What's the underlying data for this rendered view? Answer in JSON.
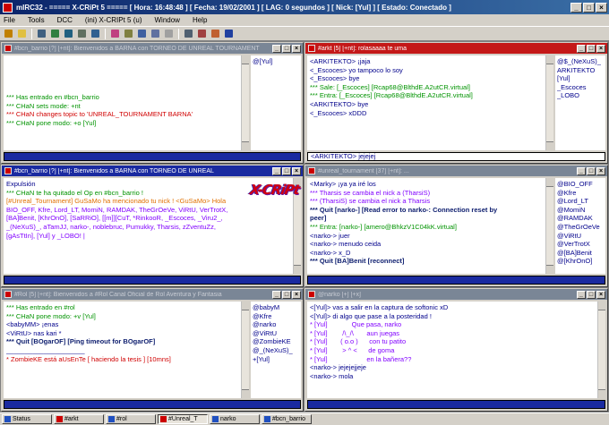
{
  "app": {
    "title": "mIRC32 - ===== X-CRiPt 5 ===== [ Hora: 16:48:48 ] [ Fecha: 19/02/2001 ] [ LAG: 0 segundos ] [ Nick: [Yul] ] [ Estado: Conectado ]",
    "min": "_",
    "max": "□",
    "close": "×"
  },
  "menu": [
    "File",
    "Tools",
    "DCC",
    "(ini) X-CRIPt 5 (u)",
    "Window",
    "Help"
  ],
  "toolbar": {
    "icons": [
      "lightning-icon",
      "folder-icon",
      "options-icon",
      "address-book-icon",
      "channels-icon",
      "dcc-send-icon",
      "dcc-chat-icon",
      "colors-icon",
      "logs-icon",
      "scripts-icon",
      "notify-icon",
      "url-icon",
      "tile-icon",
      "cascade-icon",
      "ignore-icon",
      "help-icon"
    ],
    "colors": [
      "#c08000",
      "#e0c040",
      "#406080",
      "#308040",
      "#206080",
      "#607060",
      "#306090",
      "#c04080",
      "#808040",
      "#4060a0",
      "#6070a0",
      "#a0a0a0",
      "#506070",
      "#a04040",
      "#c06030",
      "#2040a0"
    ]
  },
  "windows": {
    "top_left": {
      "title": "#bcn_barrio [?] [+nt]: Bienvenidos a BARNA con TORNEO DE UNREAL TOURNAMENT",
      "lines": [
        {
          "t": "*** Has entrado en #bcn_barrio",
          "c": "c-green"
        },
        {
          "t": "*** CHaN sets mode: +nt",
          "c": "c-green"
        },
        {
          "t": "*** CHaN changes topic to 'UNREAL_TOURNAMENT BARNA'",
          "c": "c-red"
        },
        {
          "t": "*** CHaN pone modo: +o [Yul]",
          "c": "c-green"
        }
      ],
      "nicks": [
        "@[Yul]"
      ]
    },
    "top_right": {
      "title": "#arkt [5] [+nt]: rolasaaaa te uma",
      "lines": [
        {
          "t": "<ARKITEKTO> ¡jaja",
          "c": "c-blue"
        },
        {
          "t": "<_Escoces> yo tampoco lo soy",
          "c": "c-blue"
        },
        {
          "t": "<_Escoces> bye",
          "c": "c-blue"
        },
        {
          "t": "*** Sale: [_Escoces] [Rcap68@BlthdE.A2utCR.virtual]",
          "c": "c-green"
        },
        {
          "t": "*** Entra: [_Escoces] [Rcap68@BlthdE.A2utCR.virtual]",
          "c": "c-green"
        },
        {
          "t": "<ARKITEKTO> bye",
          "c": "c-blue"
        },
        {
          "t": "<_Escoces> xDDD",
          "c": "c-blue"
        }
      ],
      "input_line": "<ARKITEKTO> jejejej",
      "nicks": [
        "@$_(NeXuS)_",
        "ARKITEKTO",
        "[Yul]",
        "_Escoces",
        "_LOBO"
      ]
    },
    "middle_left": {
      "title": "#bcn_barrio [?] [+nt]: Bienvenidos a BARNA con TORNEO DE UNREAL",
      "lines": [
        {
          "t": "Expulsión",
          "c": "c-blue"
        },
        {
          "t": "*** CHaN te ha quitado el Op en #bcn_barrio !",
          "c": "c-green"
        },
        {
          "t": "",
          "c": ""
        },
        {
          "t": "[#Unreal_Tournament] GuSaMo ha mencionado tu nick ! <GuSaMo> Hola",
          "c": "c-orange"
        },
        {
          "t": "BIO_OFF, Kfre, Lord_LT, MomiN, RAMDAK, TheGrOeVe, ViRtU, VerTrotX,",
          "c": "c-purple"
        },
        {
          "t": "[BA]Benit, [KhrOnO], [SaRRiO], [[m]][CuT, *RinkooR, _Escoces, _Viru2_,",
          "c": "c-purple"
        },
        {
          "t": "_(NeXuS)_, aTamJJ, narko-, noblebruc, Pumukky, Tharsis, zZventuZz,",
          "c": "c-purple"
        },
        {
          "t": "[gAsTtIn], [Yul] y _LOBO! |",
          "c": "c-purple"
        }
      ],
      "logo": "X-CRiPt"
    },
    "middle_right": {
      "title": "#unreal_tournament [37] [+nt]: ...",
      "lines": [
        {
          "t": "<Marky> ¡ya ya iré los",
          "c": "c-blue"
        },
        {
          "t": "*** Tharsis se cambia el nick a (TharsiS)",
          "c": "c-purple"
        },
        {
          "t": "*** (TharsiS) se cambia el nick a Tharsis",
          "c": "c-purple"
        },
        {
          "t": "*** Quit [narko-] [Read error to narko-: Connection reset by",
          "c": "c-navy"
        },
        {
          "t": "peer]",
          "c": "c-navy"
        },
        {
          "t": "*** Entra: [narko-] [amero@BhkzV1C04kK.virtual]",
          "c": "c-green"
        },
        {
          "t": "<narko-> juer",
          "c": "c-blue"
        },
        {
          "t": "<narko-> menudo ceida",
          "c": "c-blue"
        },
        {
          "t": "<narko-> x_D",
          "c": "c-blue"
        },
        {
          "t": "*** Quit [BA]Benit [reconnect]",
          "c": "c-navy"
        }
      ],
      "nicks": [
        "@BIO_OFF",
        "@Kfre",
        "@Lord_LT",
        "@MomiN",
        "@RAMDAK",
        "@TheGrOeVe",
        "@ViRtU",
        "@VerTrotX",
        "@[BA]Benit",
        "@[KhrOnO]"
      ]
    },
    "bottom_left": {
      "title": "#Rol [5] [+nt]: Bienvenidos a #Rol Canal Oficial de Rol Aventura y Fantasia",
      "lines": [
        {
          "t": "",
          "c": ""
        },
        {
          "t": "*** Has entrado en #rol",
          "c": "c-green"
        },
        {
          "t": "*** CHaN pone modo: +v [Yul]",
          "c": "c-green"
        },
        {
          "t": "<babyMM> ¡enas",
          "c": "c-blue"
        },
        {
          "t": "<ViRtU> nas kari *",
          "c": "c-blue"
        },
        {
          "t": "*** Quit [BOgarOF] [Ping timeout for BOgarOF]",
          "c": "c-navy"
        },
        {
          "t": "_____________________",
          "c": "c-blue"
        },
        {
          "t": "* ZombieKE está aUsEnTe [ haciendo la tesis ] [10mns]",
          "c": "c-red"
        }
      ],
      "nicks": [
        "@babyM",
        "@Kfre",
        "@narko",
        "@ViRtU",
        "@ZombieKE",
        "@_(NeXuS)_",
        "+[Yul]"
      ]
    },
    "bottom_right": {
      "title": "@narko [+] [+x]",
      "lines": [
        {
          "t": "<[Yul]> vas a salir en la captura de softonic xD",
          "c": "c-blue"
        },
        {
          "t": "<[Yul]> di algo que pase a la posteridad !",
          "c": "c-blue"
        },
        {
          "t": "* [Yul]             Que pasa, narko",
          "c": "c-purple"
        },
        {
          "t": "* [Yul]        /\\_/\\       aun juegas",
          "c": "c-purple"
        },
        {
          "t": "* [Yul]       ( o.o )      con tu patito",
          "c": "c-purple"
        },
        {
          "t": "* [Yul]        > ^ <      de goma",
          "c": "c-purple"
        },
        {
          "t": "* [Yul]                     en la bañera??",
          "c": "c-purple"
        },
        {
          "t": "<narko-> jejejejjeje",
          "c": "c-blue"
        },
        {
          "t": "<narko-> mola",
          "c": "c-blue"
        }
      ]
    }
  },
  "taskbar": [
    {
      "label": "Status",
      "red": false,
      "pressed": false
    },
    {
      "label": "#arkt",
      "red": true,
      "pressed": false
    },
    {
      "label": "#rol",
      "red": false,
      "pressed": false
    },
    {
      "label": "#Unreal_T",
      "red": true,
      "pressed": true
    },
    {
      "label": "narko",
      "red": false,
      "pressed": false
    },
    {
      "label": "#bcn_barrio",
      "red": false,
      "pressed": false
    }
  ]
}
